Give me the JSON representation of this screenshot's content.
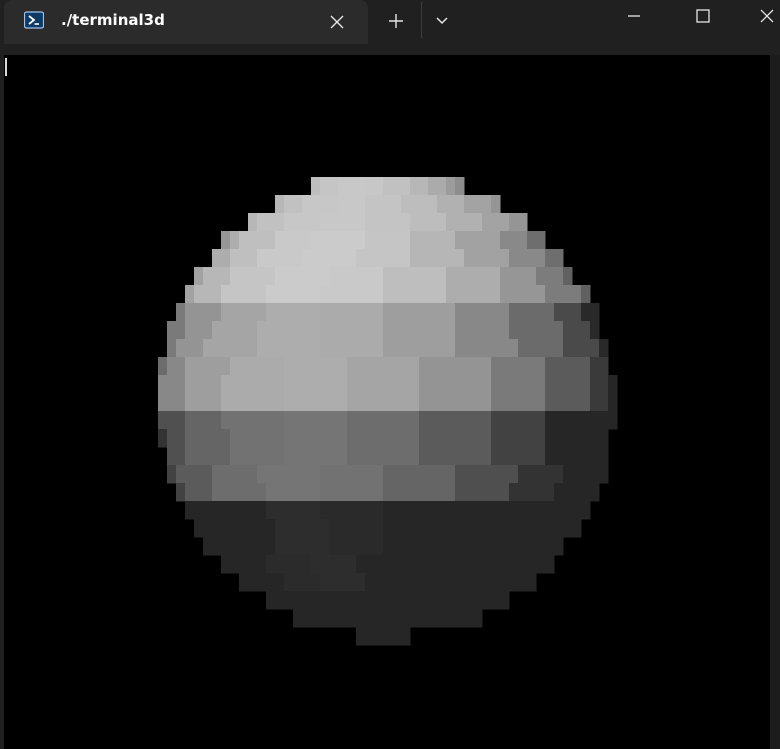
{
  "window": {
    "tab_title": "./terminal3d",
    "tab_icon": "powershell-icon",
    "close_tab_icon": "close-icon",
    "new_tab_icon": "plus-icon",
    "dropdown_icon": "chevron-down-icon",
    "minimize_icon": "minimize-icon",
    "maximize_icon": "maximize-icon",
    "close_window_icon": "close-icon"
  },
  "terminal": {
    "background": "#000000",
    "content": "shaded-3d-sphere-render",
    "cursor_visible": true
  },
  "colors": {
    "titlebar": "#202020",
    "tab": "#2b2b2b",
    "text": "#ffffff",
    "sphere_highlight": "#c8c8c8",
    "sphere_shadow": "#262626"
  }
}
